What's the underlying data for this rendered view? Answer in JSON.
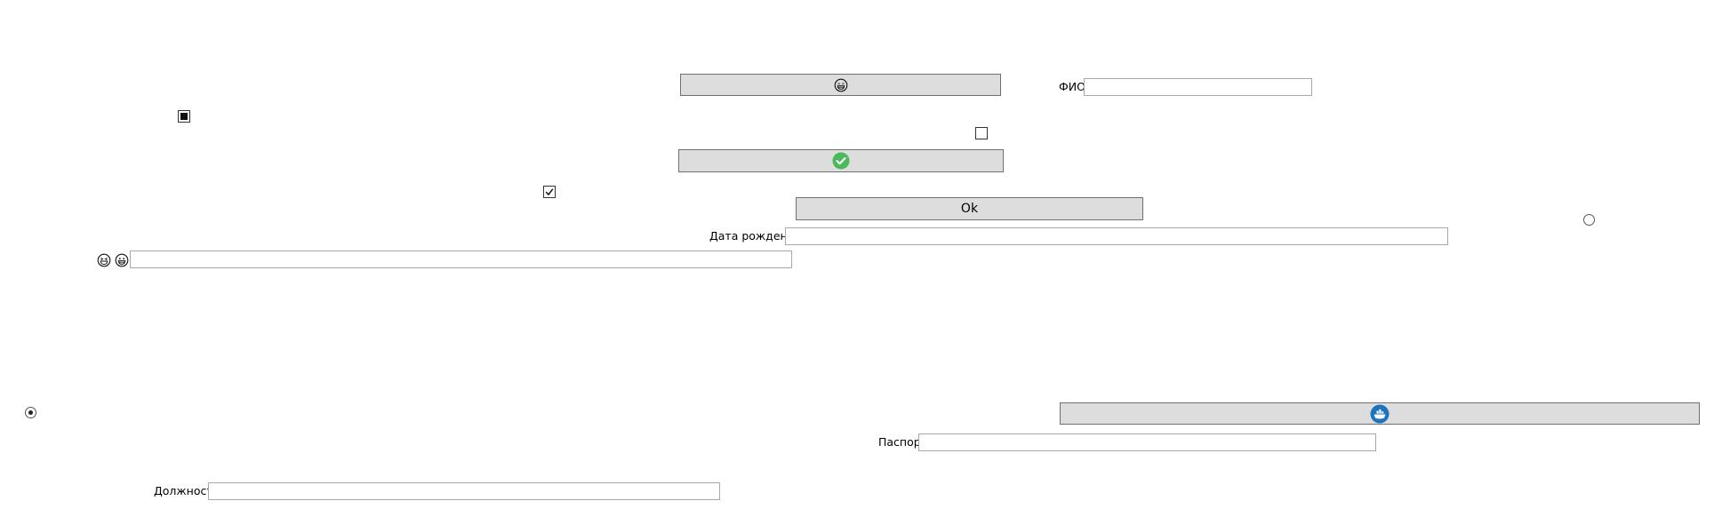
{
  "form": {
    "buttons": {
      "emoji_button": {
        "icon": "grinning-emoji-icon"
      },
      "check_button": {
        "icon": "green-checkmark-circle-icon"
      },
      "ok_button": {
        "label": "Ok"
      },
      "ship_button": {
        "icon": "blue-ship-circle-icon"
      }
    },
    "fields": {
      "fio": {
        "label": "ФИО",
        "value": ""
      },
      "birth_date": {
        "label": "Дата рождения",
        "value": ""
      },
      "passport": {
        "label": "Паспорт",
        "value": ""
      },
      "position": {
        "label": "Должность",
        "value": ""
      },
      "emoji_field": {
        "label_icons": [
          "laughing-emoji-icon",
          "grinning-emoji-icon"
        ],
        "value": ""
      }
    },
    "checkboxes": {
      "checkbox_indeterminate": {
        "state": "indeterminate"
      },
      "checkbox_unchecked": {
        "state": "unchecked"
      },
      "checkbox_checked": {
        "state": "checked"
      }
    },
    "radios": {
      "radio_unselected": {
        "selected": false
      },
      "radio_selected": {
        "selected": true
      }
    },
    "colors": {
      "button_bg": "#dddddd",
      "button_border": "#707070",
      "field_border": "#a8a8a8",
      "check_green": "#4cb85c",
      "ship_blue": "#1e73be"
    }
  }
}
